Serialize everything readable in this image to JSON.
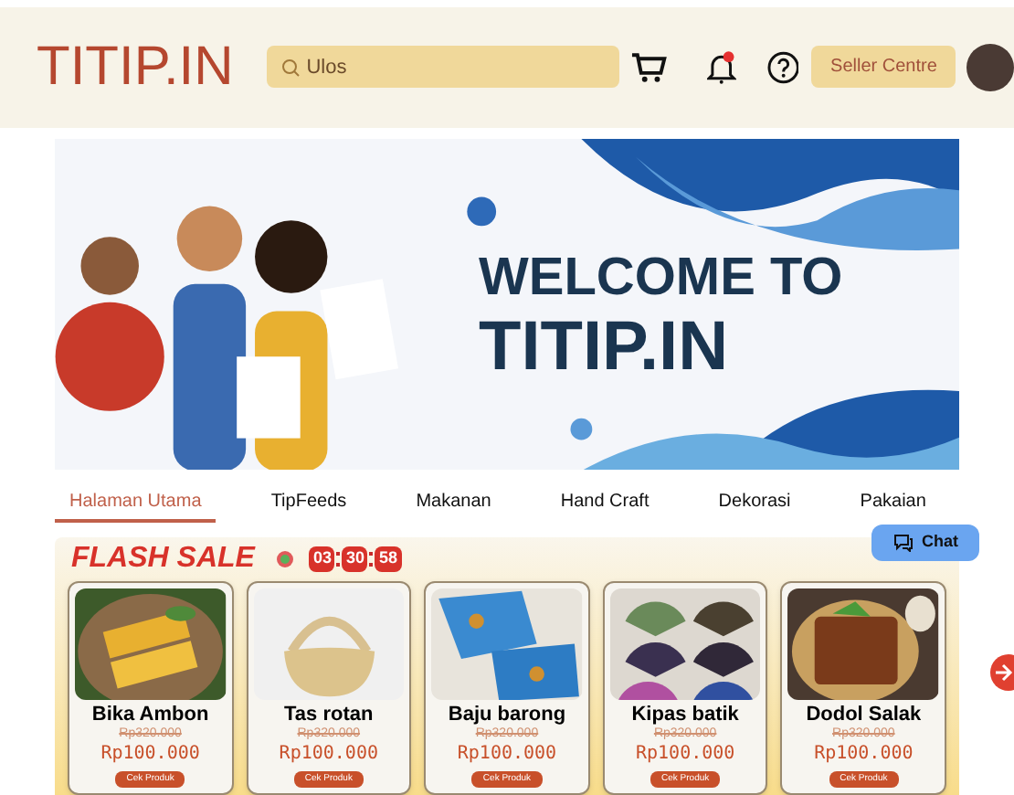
{
  "header": {
    "logo": "TITIP.IN",
    "search": {
      "value": "Ulos"
    },
    "notification_dot": true,
    "seller_button": "Seller Centre"
  },
  "banner": {
    "heading_line_1": "WELCOME TO",
    "heading_line_2": "TITIP.IN"
  },
  "tabs": [
    {
      "label": "Halaman Utama",
      "selected": true
    },
    {
      "label": "TipFeeds",
      "selected": false
    },
    {
      "label": "Makanan",
      "selected": false
    },
    {
      "label": "Hand Craft",
      "selected": false
    },
    {
      "label": "Dekorasi",
      "selected": false
    },
    {
      "label": "Pakaian",
      "selected": false
    }
  ],
  "chat_button": "Chat",
  "flash_sale": {
    "title": "FLASH SALE",
    "countdown": [
      "03",
      "30",
      "58"
    ],
    "products": [
      {
        "name": "Bika Ambon",
        "old_price": "Rp320.000",
        "price": "Rp100.000",
        "button": "Cek Produk",
        "kind": "cake"
      },
      {
        "name": "Tas rotan",
        "old_price": "Rp320.000",
        "price": "Rp100.000",
        "button": "Cek Produk",
        "kind": "bag"
      },
      {
        "name": "Baju barong",
        "old_price": "Rp320.000",
        "price": "Rp100.000",
        "button": "Cek Produk",
        "kind": "cloth"
      },
      {
        "name": "Kipas batik",
        "old_price": "Rp320.000",
        "price": "Rp100.000",
        "button": "Cek Produk",
        "kind": "fans"
      },
      {
        "name": "Dodol Salak",
        "old_price": "Rp320.000",
        "price": "Rp100.000",
        "button": "Cek Produk",
        "kind": "dodol"
      }
    ]
  }
}
